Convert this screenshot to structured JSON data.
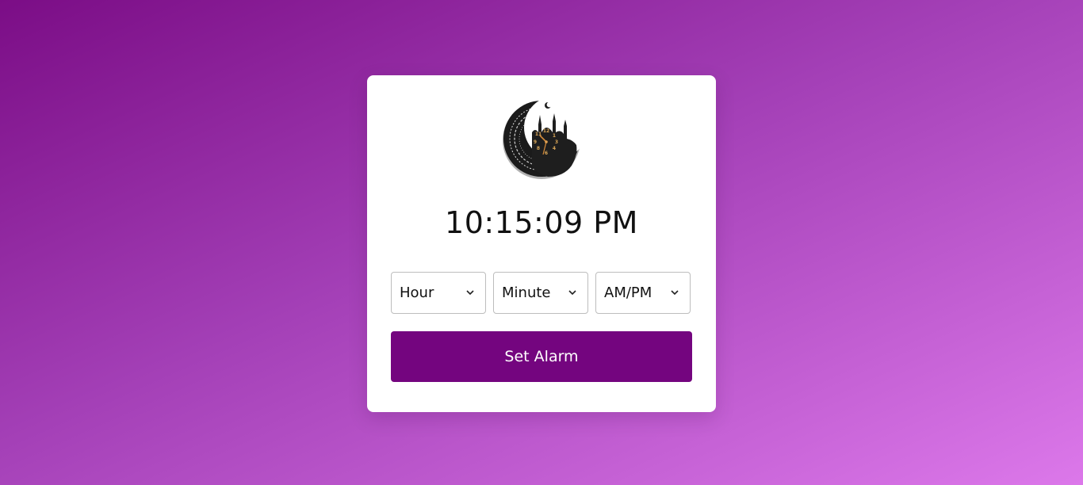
{
  "clock": {
    "current_time": "10:15:09 PM",
    "logo_icon": "crescent-mosque-clock-icon"
  },
  "alarm": {
    "hour_label": "Hour",
    "minute_label": "Minute",
    "ampm_label": "AM/PM",
    "set_button_label": "Set Alarm"
  },
  "colors": {
    "accent": "#74057f",
    "gradient_start": "#7b0d86",
    "gradient_end": "#dc78ea",
    "card": "#ffffff"
  }
}
